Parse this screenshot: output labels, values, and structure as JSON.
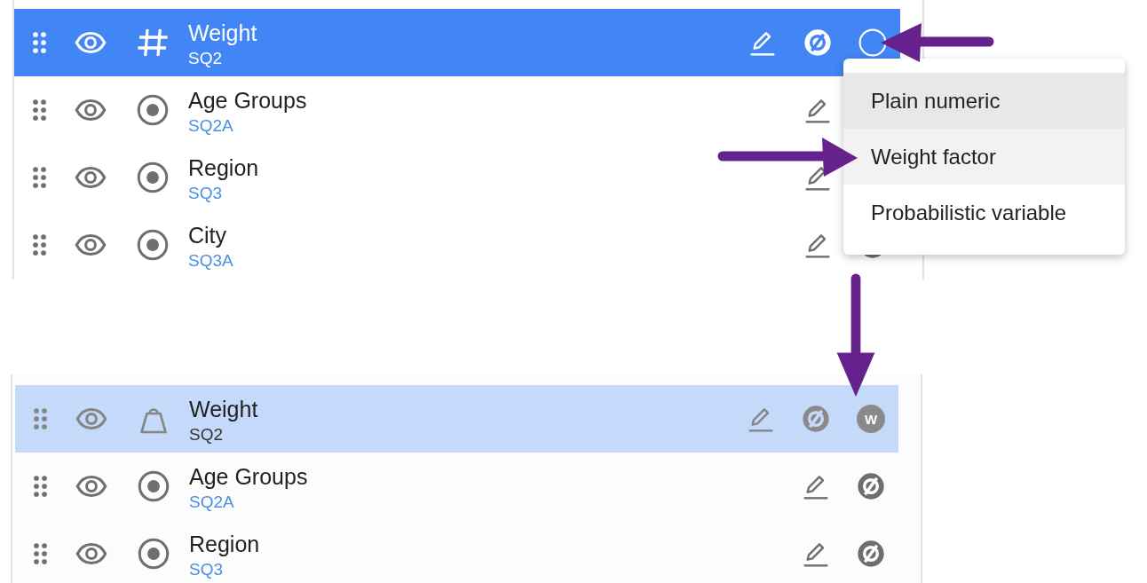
{
  "panels": [
    {
      "rows": [
        {
          "name": "Weight",
          "code": "SQ2",
          "kind": "numeric",
          "selected": true,
          "focused": true,
          "null_icon": true,
          "extra": {
            "kind": "circle"
          }
        },
        {
          "name": "Age Groups",
          "code": "SQ2A",
          "kind": "single",
          "selected": false,
          "focused": false
        },
        {
          "name": "Region",
          "code": "SQ3",
          "kind": "single",
          "selected": false,
          "focused": false
        },
        {
          "name": "City",
          "code": "SQ3A",
          "kind": "single",
          "selected": false,
          "focused": false,
          "null_icon": true
        }
      ]
    },
    {
      "rows": [
        {
          "name": "Weight",
          "code": "SQ2",
          "kind": "weight",
          "selected": true,
          "focused": false,
          "null_icon": true,
          "extra": {
            "kind": "badge",
            "text": "W"
          }
        },
        {
          "name": "Age Groups",
          "code": "SQ2A",
          "kind": "single",
          "selected": false,
          "focused": false,
          "null_icon": true
        },
        {
          "name": "Region",
          "code": "SQ3",
          "kind": "single",
          "selected": false,
          "focused": false,
          "null_icon": true
        }
      ]
    }
  ],
  "menu": {
    "items": [
      {
        "label": "Plain numeric",
        "hovered": true,
        "selected": false
      },
      {
        "label": "Weight factor",
        "hovered": false,
        "selected": true
      },
      {
        "label": "Probabilistic variable",
        "hovered": false,
        "selected": false
      }
    ]
  },
  "annotations": [
    {
      "kind": "left"
    },
    {
      "kind": "right"
    },
    {
      "kind": "down"
    }
  ]
}
